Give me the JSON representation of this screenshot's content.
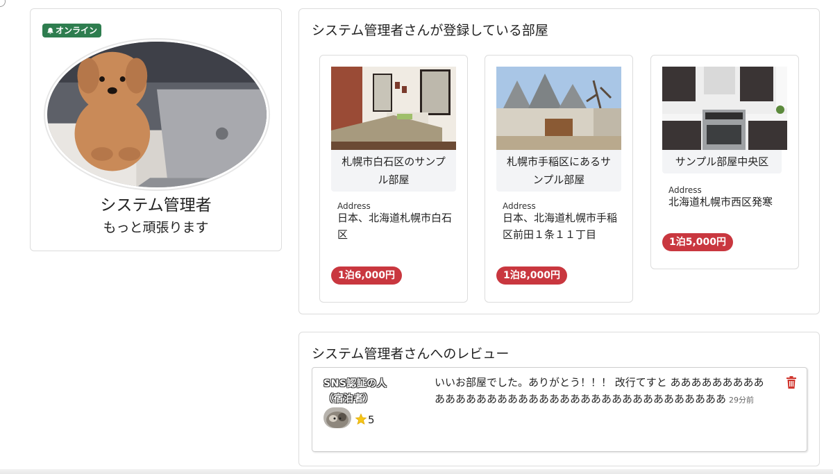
{
  "profile": {
    "status_badge": "オンライン",
    "name": "システム管理者",
    "message": "もっと頑張ります"
  },
  "rooms_section": {
    "title": "システム管理者さんが登録している部屋",
    "rooms": [
      {
        "title": "札幌市白石区のサンプル部屋",
        "address_label": "Address",
        "address": "日本、北海道札幌市白石区",
        "price": "1泊6,000円"
      },
      {
        "title": "札幌市手稲区にあるサンプル部屋",
        "address_label": "Address",
        "address": "日本、北海道札幌市手稲区前田１条１１丁目",
        "price": "1泊8,000円"
      },
      {
        "title": "サンプル部屋中央区",
        "address_label": "Address",
        "address": "北海道札幌市西区発寒",
        "price": "1泊5,000円"
      }
    ]
  },
  "reviews_section": {
    "title": "システム管理者さんへのレビュー",
    "reviews": [
      {
        "reviewer": "SNS認証の人（宿泊者）",
        "rating": "5",
        "text": "いいお部屋でした。ありがとう！！！ 改行てすと あああああああああああああああああああああああああああああああああああああ",
        "time": "29分前"
      }
    ]
  },
  "colors": {
    "online": "#2e7d4f",
    "price": "#c9373f",
    "delete": "#d0342c"
  },
  "icons": {
    "badge": "bell-icon",
    "rating": "star-icon",
    "delete": "trash-icon"
  }
}
